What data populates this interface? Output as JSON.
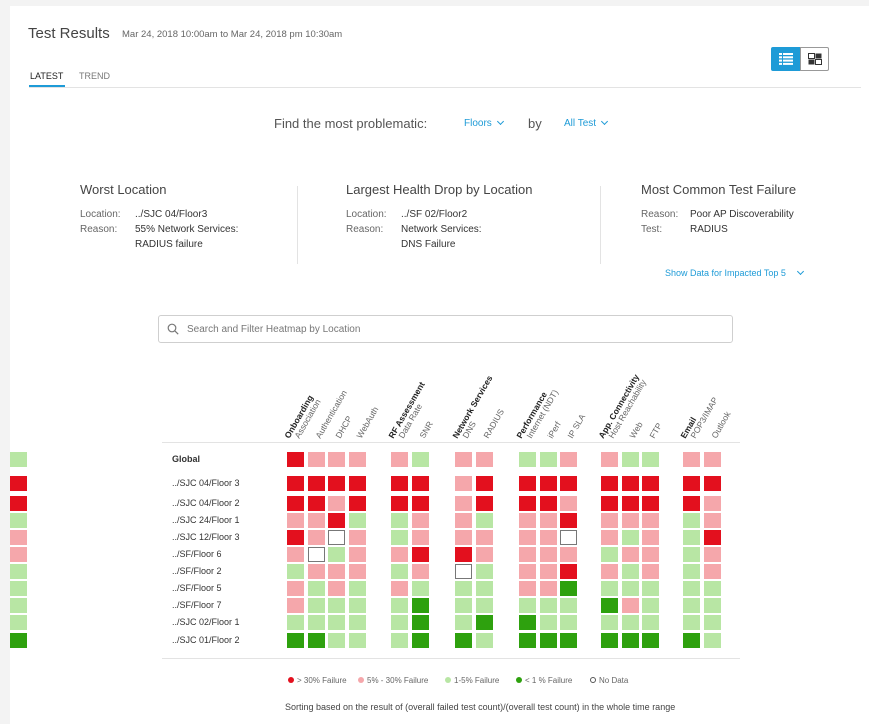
{
  "header": {
    "title": "Test Results",
    "date_range": "Mar 24, 2018 10:00am to Mar 24, 2018 pm 10:30am"
  },
  "tabs": [
    {
      "label": "LATEST",
      "active": true
    },
    {
      "label": "TREND",
      "active": false
    }
  ],
  "view_toggle": {
    "list_icon": "list-view-icon",
    "grid_icon": "grid-view-icon"
  },
  "filter": {
    "prefix": "Find the most problematic:",
    "floors_label": "Floors",
    "by_label": "by",
    "test_label": "All Test"
  },
  "cards": {
    "worst": {
      "title": "Worst Location",
      "location_key": "Location:",
      "location_val": "../SJC 04/Floor3",
      "reason_key": "Reason:",
      "reason_line1": "55% Network Services:",
      "reason_line2": "RADIUS failure"
    },
    "drop": {
      "title": "Largest Health Drop by Location",
      "location_key": "Location:",
      "location_val": "../SF 02/Floor2",
      "reason_key": "Reason:",
      "reason_line1": "Network Services:",
      "reason_line2": "DNS Failure"
    },
    "common": {
      "title": "Most Common Test Failure",
      "reason_key": "Reason:",
      "reason_val": "Poor AP Discoverability",
      "test_key": "Test:",
      "test_val": "RADIUS"
    }
  },
  "show_data_label": "Show Data for Impacted Top 5",
  "search": {
    "placeholder": "Search and Filter Heatmap by Location"
  },
  "heatmap": {
    "groups": [
      {
        "name": "Onboarding",
        "columns": [
          "Association",
          "Authentication",
          "DHCP",
          "WebAuth"
        ]
      },
      {
        "name": "RF Assessment",
        "columns": [
          "Data Rate",
          "SNR"
        ]
      },
      {
        "name": "Network Services",
        "columns": [
          "DNS",
          "RADIUS"
        ]
      },
      {
        "name": "Performance",
        "columns": [
          "Internet (NDT)",
          "iPerf",
          "IP SLA"
        ]
      },
      {
        "name": "App. Connectivity",
        "columns": [
          "Host Reachability",
          "Web",
          "FTP"
        ]
      },
      {
        "name": "Email",
        "columns": [
          "POP3/IMAP",
          "Outlook"
        ]
      }
    ],
    "rows": [
      {
        "label": "Global",
        "cells": [
          "R",
          "P",
          "P",
          "P",
          "P",
          "L",
          "P",
          "P",
          "L",
          "L",
          "P",
          "P",
          "L",
          "L",
          "P",
          "P",
          "L"
        ]
      },
      {
        "label": "../SJC 04/Floor 3",
        "cells": [
          "R",
          "R",
          "R",
          "R",
          "R",
          "R",
          "P",
          "R",
          "R",
          "R",
          "R",
          "R",
          "R",
          "R",
          "R",
          "R",
          "R"
        ]
      },
      {
        "label": "../SJC 04/Floor 2",
        "cells": [
          "R",
          "R",
          "P",
          "R",
          "R",
          "R",
          "P",
          "R",
          "R",
          "R",
          "P",
          "R",
          "R",
          "R",
          "R",
          "P",
          "R"
        ]
      },
      {
        "label": "../SJC 24/Floor 1",
        "cells": [
          "P",
          "P",
          "R",
          "L",
          "L",
          "P",
          "P",
          "L",
          "P",
          "P",
          "R",
          "P",
          "P",
          "P",
          "L",
          "P",
          "L"
        ]
      },
      {
        "label": "../SJC 12/Floor 3",
        "cells": [
          "R",
          "P",
          "N",
          "P",
          "L",
          "P",
          "P",
          "P",
          "P",
          "P",
          "N",
          "P",
          "L",
          "P",
          "L",
          "R",
          "P"
        ]
      },
      {
        "label": "../SF/Floor 6",
        "cells": [
          "P",
          "N",
          "L",
          "P",
          "P",
          "R",
          "R",
          "P",
          "P",
          "P",
          "P",
          "L",
          "P",
          "P",
          "L",
          "P",
          "P"
        ]
      },
      {
        "label": "../SF/Floor 2",
        "cells": [
          "L",
          "P",
          "P",
          "P",
          "L",
          "P",
          "N",
          "L",
          "P",
          "P",
          "R",
          "P",
          "L",
          "P",
          "L",
          "P",
          "L"
        ]
      },
      {
        "label": "../SF/Floor 5",
        "cells": [
          "P",
          "L",
          "P",
          "L",
          "P",
          "L",
          "L",
          "L",
          "P",
          "P",
          "G",
          "L",
          "L",
          "L",
          "L",
          "L",
          "L"
        ]
      },
      {
        "label": "../SF/Floor 7",
        "cells": [
          "P",
          "L",
          "L",
          "L",
          "L",
          "G",
          "L",
          "L",
          "L",
          "L",
          "L",
          "G",
          "P",
          "L",
          "L",
          "L",
          "L"
        ]
      },
      {
        "label": "../SJC 02/Floor 1",
        "cells": [
          "L",
          "L",
          "L",
          "L",
          "L",
          "G",
          "L",
          "G",
          "G",
          "L",
          "L",
          "L",
          "L",
          "L",
          "L",
          "L",
          "L"
        ]
      },
      {
        "label": "../SJC 01/Floor 2",
        "cells": [
          "G",
          "G",
          "L",
          "L",
          "L",
          "G",
          "G",
          "L",
          "G",
          "G",
          "G",
          "G",
          "G",
          "G",
          "G",
          "L",
          "G"
        ]
      }
    ]
  },
  "colors": {
    "R": "#e3101e",
    "P": "#f5a7ab",
    "L": "#b8e6a4",
    "G": "#2ea10e",
    "N": "#ffffff",
    "accent": "#1e9bd7"
  },
  "legend": [
    {
      "key": "R",
      "label": "> 30% Failure"
    },
    {
      "key": "P",
      "label": "5% - 30% Failure"
    },
    {
      "key": "L",
      "label": "1-5% Failure"
    },
    {
      "key": "G",
      "label": "< 1 % Failure"
    },
    {
      "key": "N",
      "label": "No Data"
    }
  ],
  "footnote": "Sorting based on the result of (overall failed test count)/(overall test count) in the whole time range"
}
